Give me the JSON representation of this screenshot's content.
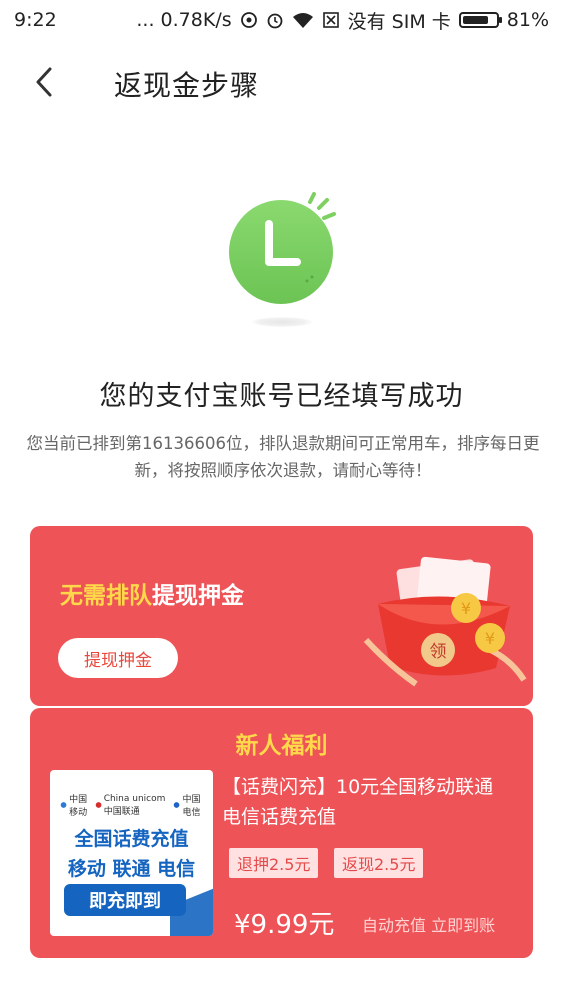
{
  "status_bar": {
    "time": "9:22",
    "network": "... 0.78K/s",
    "sim": "没有 SIM 卡",
    "battery": "81%",
    "battery_level": 0.81
  },
  "header": {
    "title": "返现金步骤",
    "back_icon": "chevron-left-icon"
  },
  "status": {
    "icon": "clock-icon",
    "headline": "您的支付宝账号已经填写成功",
    "description": "您当前已排到第16136606位，排队退款期间可正常用车，排序每日更新，将按照顺序依次退款，请耐心等待！"
  },
  "withdraw_card": {
    "highlight": "无需排队",
    "text": "提现押金",
    "button_label": "提现押金",
    "envelope_text": "领"
  },
  "welfare_card": {
    "title": "新人福利",
    "product": {
      "image_line1": "全国话费充值",
      "image_line2": "移动 联通 电信",
      "image_badge": "即充即到",
      "carriers": [
        "中国移动",
        "China unicom中国联通",
        "中国电信"
      ],
      "name": "【话费闪充】10元全国移动联通电信话费充值",
      "tags": [
        "退押2.5元",
        "返现2.5元"
      ],
      "price": "¥9.99元",
      "perks": "自动充值 立即到账"
    }
  },
  "colors": {
    "card_red": "#ee5357",
    "highlight_yellow": "#ffd94a",
    "clock_green": "#7ed063"
  }
}
